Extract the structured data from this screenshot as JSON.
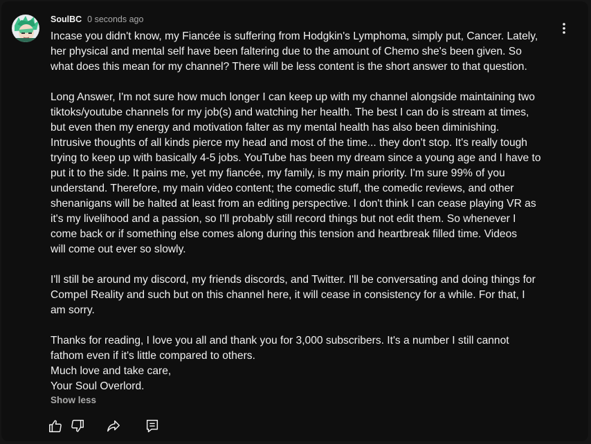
{
  "comment": {
    "author": "SoulBC",
    "timestamp": "0 seconds ago",
    "avatar_icon": "anime-character-avatar",
    "paragraphs": [
      [
        "Incase you didn't know, my Fiancée is suffering from Hodgkin's Lymphoma, simply put, Cancer. Lately,",
        "her physical and mental self have been faltering due to the amount of Chemo she's been given. So",
        "what does this mean for my channel? There will be less content is the short answer to that question."
      ],
      [
        "Long Answer, I'm not sure how much longer I can keep up with my channel alongside maintaining two",
        "tiktoks/youtube channels for my job(s) and watching her health. The best I can do is stream at times,",
        "but even then my energy and motivation falter as my mental health has also been diminishing.",
        "Intrusive thoughts of all kinds pierce my head and most of the time... they don't stop. It's really tough",
        "trying to keep up with basically 4-5 jobs. YouTube has been my dream since a young age and I have to",
        "put it to the side. It pains me, yet my fiancée, my family, is my main priority. I'm sure 99% of you",
        "understand. Therefore, my main video content; the comedic stuff, the comedic reviews, and other",
        "shenanigans will be halted at least from an editing perspective. I don't think I can cease playing VR as",
        "it's my livelihood and a passion, so I'll probably still record things but not edit them. So whenever I",
        "come back or if something else comes along during this tension and heartbreak filled time. Videos",
        "will come out ever so slowly."
      ],
      [
        "I'll still be around my discord, my friends discords, and Twitter. I'll be conversating and doing things for",
        "Compel Reality and such but on this channel here, it will cease in consistency for a while. For that, I",
        "am sorry."
      ],
      [
        "Thanks for reading, I love you all and thank you for 3,000 subscribers. It's a number I still cannot",
        "fathom even if it's little compared to others.",
        "Much love and take care,",
        "Your Soul Overlord."
      ]
    ],
    "show_less_label": "Show less"
  },
  "actions": {
    "like_icon": "thumbs-up-icon",
    "dislike_icon": "thumbs-down-icon",
    "share_icon": "share-icon",
    "reply_icon": "reply-icon",
    "menu_icon": "more-vertical-icon"
  },
  "colors": {
    "background": "#0f0f0f",
    "text": "#f1f1f1",
    "secondary_text": "#aaaaaa"
  }
}
